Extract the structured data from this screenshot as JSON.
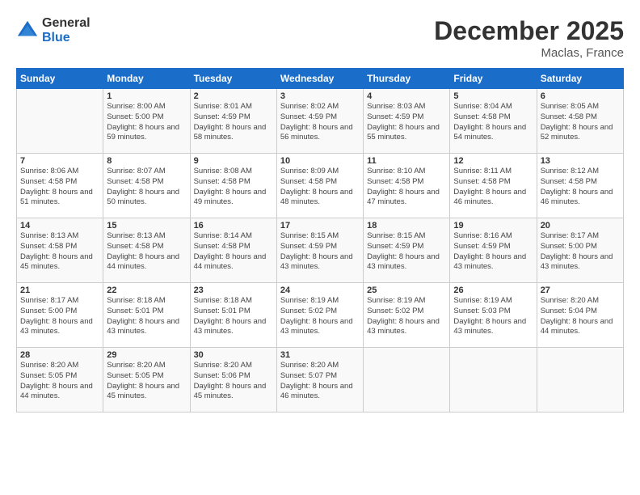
{
  "header": {
    "logo_general": "General",
    "logo_blue": "Blue",
    "month_title": "December 2025",
    "location": "Maclas, France"
  },
  "weekdays": [
    "Sunday",
    "Monday",
    "Tuesday",
    "Wednesday",
    "Thursday",
    "Friday",
    "Saturday"
  ],
  "weeks": [
    [
      {
        "day": "",
        "sunrise": "",
        "sunset": "",
        "daylight": ""
      },
      {
        "day": "1",
        "sunrise": "Sunrise: 8:00 AM",
        "sunset": "Sunset: 5:00 PM",
        "daylight": "Daylight: 8 hours and 59 minutes."
      },
      {
        "day": "2",
        "sunrise": "Sunrise: 8:01 AM",
        "sunset": "Sunset: 4:59 PM",
        "daylight": "Daylight: 8 hours and 58 minutes."
      },
      {
        "day": "3",
        "sunrise": "Sunrise: 8:02 AM",
        "sunset": "Sunset: 4:59 PM",
        "daylight": "Daylight: 8 hours and 56 minutes."
      },
      {
        "day": "4",
        "sunrise": "Sunrise: 8:03 AM",
        "sunset": "Sunset: 4:59 PM",
        "daylight": "Daylight: 8 hours and 55 minutes."
      },
      {
        "day": "5",
        "sunrise": "Sunrise: 8:04 AM",
        "sunset": "Sunset: 4:58 PM",
        "daylight": "Daylight: 8 hours and 54 minutes."
      },
      {
        "day": "6",
        "sunrise": "Sunrise: 8:05 AM",
        "sunset": "Sunset: 4:58 PM",
        "daylight": "Daylight: 8 hours and 52 minutes."
      }
    ],
    [
      {
        "day": "7",
        "sunrise": "Sunrise: 8:06 AM",
        "sunset": "Sunset: 4:58 PM",
        "daylight": "Daylight: 8 hours and 51 minutes."
      },
      {
        "day": "8",
        "sunrise": "Sunrise: 8:07 AM",
        "sunset": "Sunset: 4:58 PM",
        "daylight": "Daylight: 8 hours and 50 minutes."
      },
      {
        "day": "9",
        "sunrise": "Sunrise: 8:08 AM",
        "sunset": "Sunset: 4:58 PM",
        "daylight": "Daylight: 8 hours and 49 minutes."
      },
      {
        "day": "10",
        "sunrise": "Sunrise: 8:09 AM",
        "sunset": "Sunset: 4:58 PM",
        "daylight": "Daylight: 8 hours and 48 minutes."
      },
      {
        "day": "11",
        "sunrise": "Sunrise: 8:10 AM",
        "sunset": "Sunset: 4:58 PM",
        "daylight": "Daylight: 8 hours and 47 minutes."
      },
      {
        "day": "12",
        "sunrise": "Sunrise: 8:11 AM",
        "sunset": "Sunset: 4:58 PM",
        "daylight": "Daylight: 8 hours and 46 minutes."
      },
      {
        "day": "13",
        "sunrise": "Sunrise: 8:12 AM",
        "sunset": "Sunset: 4:58 PM",
        "daylight": "Daylight: 8 hours and 46 minutes."
      }
    ],
    [
      {
        "day": "14",
        "sunrise": "Sunrise: 8:13 AM",
        "sunset": "Sunset: 4:58 PM",
        "daylight": "Daylight: 8 hours and 45 minutes."
      },
      {
        "day": "15",
        "sunrise": "Sunrise: 8:13 AM",
        "sunset": "Sunset: 4:58 PM",
        "daylight": "Daylight: 8 hours and 44 minutes."
      },
      {
        "day": "16",
        "sunrise": "Sunrise: 8:14 AM",
        "sunset": "Sunset: 4:58 PM",
        "daylight": "Daylight: 8 hours and 44 minutes."
      },
      {
        "day": "17",
        "sunrise": "Sunrise: 8:15 AM",
        "sunset": "Sunset: 4:59 PM",
        "daylight": "Daylight: 8 hours and 43 minutes."
      },
      {
        "day": "18",
        "sunrise": "Sunrise: 8:15 AM",
        "sunset": "Sunset: 4:59 PM",
        "daylight": "Daylight: 8 hours and 43 minutes."
      },
      {
        "day": "19",
        "sunrise": "Sunrise: 8:16 AM",
        "sunset": "Sunset: 4:59 PM",
        "daylight": "Daylight: 8 hours and 43 minutes."
      },
      {
        "day": "20",
        "sunrise": "Sunrise: 8:17 AM",
        "sunset": "Sunset: 5:00 PM",
        "daylight": "Daylight: 8 hours and 43 minutes."
      }
    ],
    [
      {
        "day": "21",
        "sunrise": "Sunrise: 8:17 AM",
        "sunset": "Sunset: 5:00 PM",
        "daylight": "Daylight: 8 hours and 43 minutes."
      },
      {
        "day": "22",
        "sunrise": "Sunrise: 8:18 AM",
        "sunset": "Sunset: 5:01 PM",
        "daylight": "Daylight: 8 hours and 43 minutes."
      },
      {
        "day": "23",
        "sunrise": "Sunrise: 8:18 AM",
        "sunset": "Sunset: 5:01 PM",
        "daylight": "Daylight: 8 hours and 43 minutes."
      },
      {
        "day": "24",
        "sunrise": "Sunrise: 8:19 AM",
        "sunset": "Sunset: 5:02 PM",
        "daylight": "Daylight: 8 hours and 43 minutes."
      },
      {
        "day": "25",
        "sunrise": "Sunrise: 8:19 AM",
        "sunset": "Sunset: 5:02 PM",
        "daylight": "Daylight: 8 hours and 43 minutes."
      },
      {
        "day": "26",
        "sunrise": "Sunrise: 8:19 AM",
        "sunset": "Sunset: 5:03 PM",
        "daylight": "Daylight: 8 hours and 43 minutes."
      },
      {
        "day": "27",
        "sunrise": "Sunrise: 8:20 AM",
        "sunset": "Sunset: 5:04 PM",
        "daylight": "Daylight: 8 hours and 44 minutes."
      }
    ],
    [
      {
        "day": "28",
        "sunrise": "Sunrise: 8:20 AM",
        "sunset": "Sunset: 5:05 PM",
        "daylight": "Daylight: 8 hours and 44 minutes."
      },
      {
        "day": "29",
        "sunrise": "Sunrise: 8:20 AM",
        "sunset": "Sunset: 5:05 PM",
        "daylight": "Daylight: 8 hours and 45 minutes."
      },
      {
        "day": "30",
        "sunrise": "Sunrise: 8:20 AM",
        "sunset": "Sunset: 5:06 PM",
        "daylight": "Daylight: 8 hours and 45 minutes."
      },
      {
        "day": "31",
        "sunrise": "Sunrise: 8:20 AM",
        "sunset": "Sunset: 5:07 PM",
        "daylight": "Daylight: 8 hours and 46 minutes."
      },
      {
        "day": "",
        "sunrise": "",
        "sunset": "",
        "daylight": ""
      },
      {
        "day": "",
        "sunrise": "",
        "sunset": "",
        "daylight": ""
      },
      {
        "day": "",
        "sunrise": "",
        "sunset": "",
        "daylight": ""
      }
    ]
  ]
}
